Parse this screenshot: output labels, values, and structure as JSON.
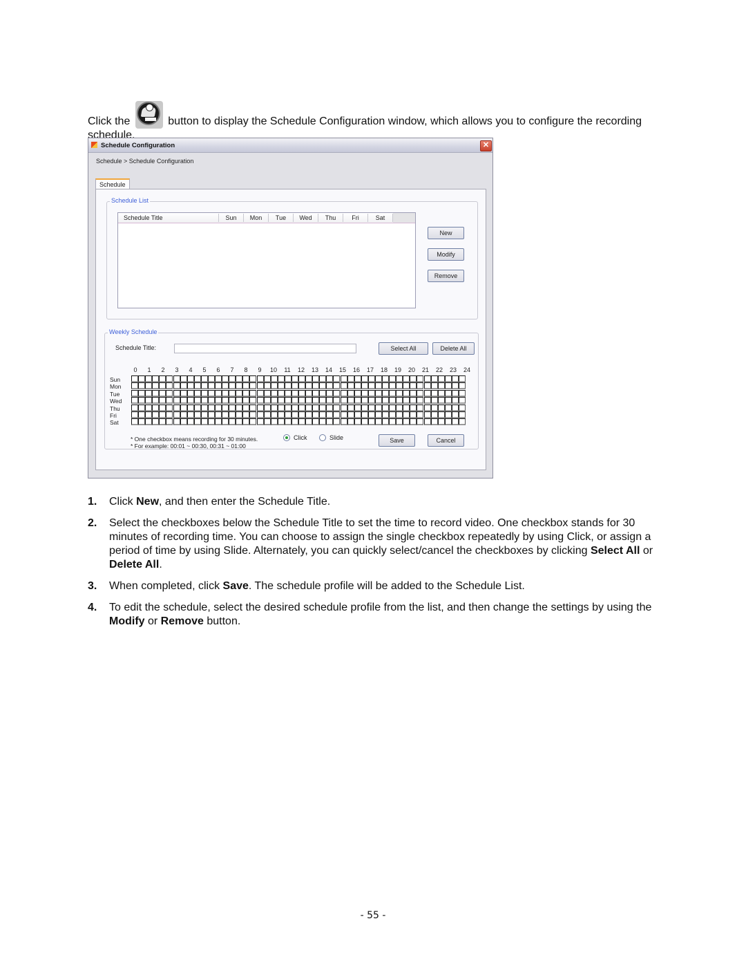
{
  "intro": {
    "before_icon": "Click the",
    "icon": "schedule-button-icon",
    "after_icon": "button to display the Schedule Configuration window, which allows you to configure the recording schedule."
  },
  "window": {
    "title": "Schedule Configuration",
    "close_icon": "close-icon",
    "breadcrumb": "Schedule > Schedule Configuration",
    "tab": "Schedule",
    "schedule_list": {
      "legend": "Schedule List",
      "columns": [
        "Schedule Title",
        "Sun",
        "Mon",
        "Tue",
        "Wed",
        "Thu",
        "Fri",
        "Sat"
      ],
      "rows": [],
      "buttons": {
        "new": "New",
        "modify": "Modify",
        "remove": "Remove"
      }
    },
    "weekly_schedule": {
      "legend": "Weekly Schedule",
      "title_label": "Schedule Title:",
      "title_value": "",
      "select_all": "Select All",
      "delete_all": "Delete All",
      "hours": [
        "0",
        "1",
        "2",
        "3",
        "4",
        "5",
        "6",
        "7",
        "8",
        "9",
        "10",
        "11",
        "12",
        "13",
        "14",
        "15",
        "16",
        "17",
        "18",
        "19",
        "20",
        "21",
        "22",
        "23",
        "24"
      ],
      "days": [
        "Sun",
        "Mon",
        "Tue",
        "Wed",
        "Thu",
        "Fri",
        "Sat"
      ],
      "slots_per_day": 48,
      "checked_slots": [],
      "note_line1": "* One checkbox means recording for 30 minutes.",
      "note_line2": "* For example: 00:01 ~ 00:30, 00:31 ~ 01:00",
      "mode_options": [
        {
          "label": "Click",
          "selected": true
        },
        {
          "label": "Slide",
          "selected": false
        }
      ],
      "save": "Save",
      "cancel": "Cancel"
    }
  },
  "steps": [
    {
      "num": "1.",
      "parts": [
        {
          "t": "Click "
        },
        {
          "t": "New",
          "b": true
        },
        {
          "t": ", and then enter the Schedule Title."
        }
      ]
    },
    {
      "num": "2.",
      "parts": [
        {
          "t": "Select the checkboxes below the Schedule Title to set the time to record video. One checkbox stands for 30 minutes of recording time. You can choose to assign the single checkbox repeatedly by using Click, or assign a period of time by using Slide. Alternately, you can quickly select/cancel the checkboxes by clicking "
        },
        {
          "t": "Select All",
          "b": true
        },
        {
          "t": " or "
        },
        {
          "t": "Delete All",
          "b": true
        },
        {
          "t": "."
        }
      ]
    },
    {
      "num": "3.",
      "parts": [
        {
          "t": "When completed, click "
        },
        {
          "t": "Save",
          "b": true
        },
        {
          "t": ". The schedule profile will be added to the Schedule List."
        }
      ]
    },
    {
      "num": "4.",
      "parts": [
        {
          "t": "To edit the schedule, select the desired schedule profile from the list, and then change the settings by using the "
        },
        {
          "t": "Modify",
          "b": true
        },
        {
          "t": " or "
        },
        {
          "t": "Remove",
          "b": true
        },
        {
          "t": " button."
        }
      ]
    }
  ],
  "page_number": "- 55 -"
}
